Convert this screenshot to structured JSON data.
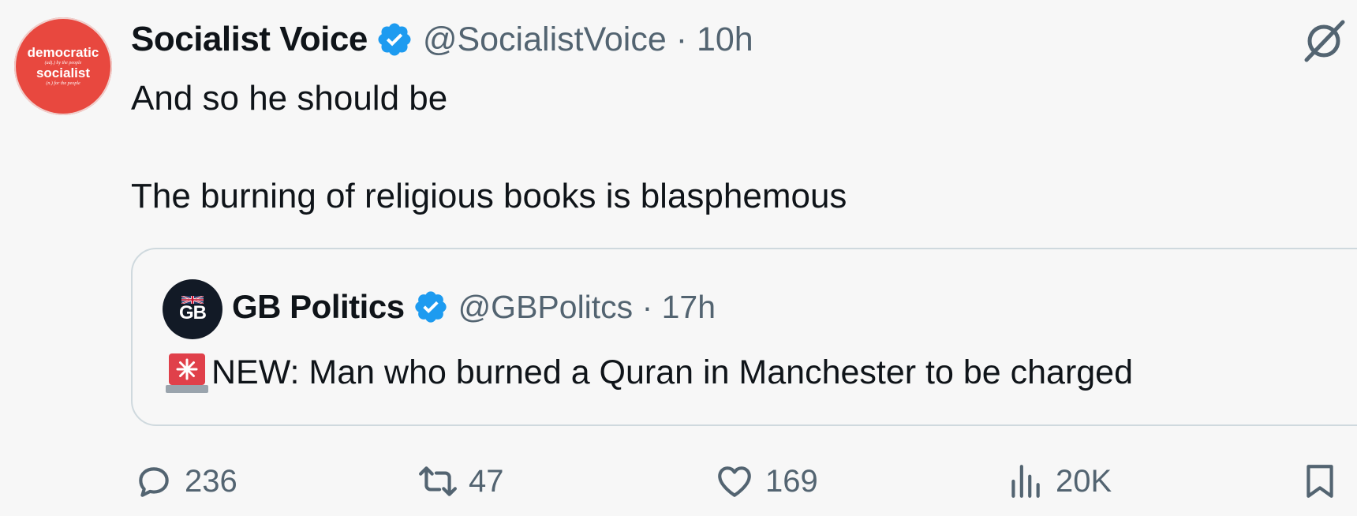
{
  "author": {
    "avatar_text": [
      "democratic",
      "(adj.) by the people",
      "socialist",
      "(n.) for the people"
    ],
    "name": "Socialist Voice",
    "handle_time": "@SocialistVoice · 10h"
  },
  "tweet": {
    "lines": [
      "And so he should be",
      "The burning of religious books is blasphemous"
    ]
  },
  "quote": {
    "avatar_text": "GB",
    "name": "GB Politics",
    "handle_time": "@GBPolitcs · 17h",
    "text": "NEW: Man who burned a Quran in Manchester to be charged"
  },
  "actions": {
    "replies": "236",
    "retweets": "47",
    "likes": "169",
    "views": "20K"
  },
  "colors": {
    "verified": "#1d9bf0",
    "avatar_red": "#e8483f",
    "secondary_text": "#536471"
  }
}
